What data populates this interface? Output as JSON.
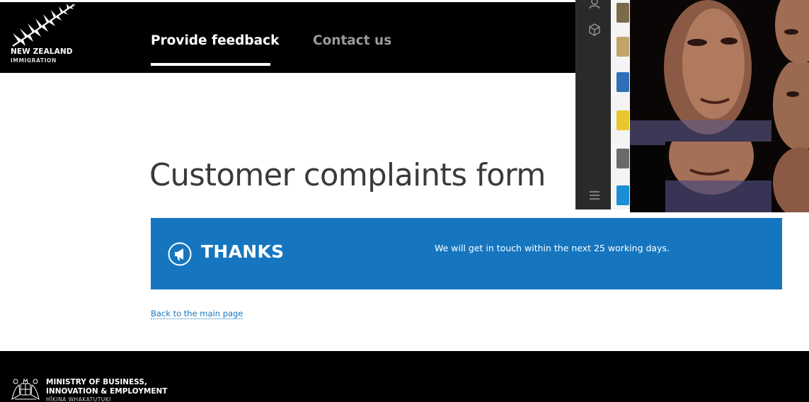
{
  "header": {
    "logo": {
      "name": "NEW ZEALAND",
      "sub": "IMMIGRATION",
      "icon": "silver-fern-icon"
    },
    "tabs": [
      {
        "label": "Provide feedback",
        "active": true
      },
      {
        "label": "Contact us",
        "active": false
      }
    ]
  },
  "main": {
    "title": "Customer complaints form",
    "panel": {
      "icon": "megaphone-icon",
      "heading": "THANKS",
      "message": "We will get in touch within the next 25 working days."
    },
    "back_link": "Back to the main page"
  },
  "footer": {
    "line1": "MINISTRY OF BUSINESS,",
    "line2": "INNOVATION & EMPLOYMENT",
    "line3": "HĪKINA WHAKATUTUKI",
    "icon": "coat-of-arms-icon"
  },
  "overlay": {
    "sidebar_icons": [
      "user-icon",
      "cube-icon",
      "menu-icon"
    ],
    "thumb_colors": [
      "#7a6a4a",
      "#c2a36a",
      "#2f6fb5",
      "#e9c82f",
      "#6a6a6a",
      "#1a8fd6"
    ]
  },
  "colors": {
    "header_bg": "#000000",
    "accent": "#1576bf",
    "title": "#3a3a3a"
  }
}
